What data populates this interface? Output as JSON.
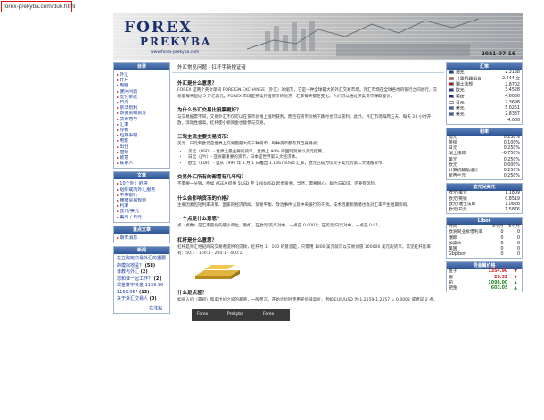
{
  "browser": {
    "url": "forex-prekyba.com/duk.html"
  },
  "banner": {
    "logo_top": "FOREX",
    "logo_bottom": "PREKYBA",
    "site_url": "www.forex-prekyba.com",
    "date": "2021-07-16"
  },
  "left": {
    "nav_title": "目录",
    "nav_items": [
      "外汇",
      "开户",
      "电脑",
      "使问问题",
      "支付条款",
      "日元",
      "依法划利",
      "该要贸细撰写",
      "货币符号",
      "汇率",
      "导致",
      "短期事物",
      "电影",
      "出仕",
      "描绘",
      "致意",
      "联系人"
    ],
    "nav2_title": "文章",
    "nav2_items": [
      "10个外汇陷阱",
      "组织或内外汇服务",
      "中央银行",
      "横彼贸易规则",
      "利率",
      "欧元/美元",
      "美元 / 日元"
    ],
    "nav3_title": "重点文章",
    "nav3_items": [
      "期市消息"
    ],
    "news_title": "新闻",
    "news": [
      {
        "text": "在立陶宛交易外汇的重要的模拟地是？",
        "count": "(58)"
      },
      {
        "text": "谁教与外汇",
        "count": "(2)"
      },
      {
        "text": "您和谁一起工作？",
        "count": "(2)"
      },
      {
        "text": "现金数字黄金 1159.95 1160.95?",
        "count": "(13)"
      },
      {
        "text": "关于外汇交易人",
        "count": "(0)"
      }
    ],
    "more": "在这些..."
  },
  "main": {
    "title": "外汇常见问题 - 扛杆手新搜证者",
    "h1": "外汇是什么意思？",
    "p1": "FOREX 是两个英文单词 FOREIGN EXCHANGE（外汇）的缩写，它是一种全球最大的外汇交易市场。外汇市场在全球各地的银行之间进行，交易量每天超过 5 万亿美元。FOREX 市场是买卖外国货币的地方，汇率每天都在变化，人们可以通过买卖货币赚取差价。",
    "h2": "为什么外汇交易比股票更好？",
    "p2": "与交易股票不同，交易外汇不仅可以在货币价格上涨时获利，而且在货币价格下跌时也可以获利。此外，外汇市场每周五天、每天 24 小时开放，流动性极高，杠杆使小额资金也能参与交易。",
    "h3": "三驾主流主要交易货币：",
    "p3": "美元、日元和欧元是世界上交易量最大的三种货币，每种货币都有其自身特点：",
    "list": [
      "美元（USD）- 世界上最主要的货币，世界上 90% 的国际贸易以美元结算。",
      "日元（JPY）- 亚洲最重要的货币，日本是世界第三大经济体。",
      "欧元（EUR）- 自从 1999 年 1 月 1 日推出 1.16675USD 汇率，欧元已成为仅次于美元的第二大储备货币。"
    ],
    "h4": "交易外汇所有的都需有几年吗？",
    "p4": "不需要一分钱，例如 AGEA 提供 5USD 至 1000USD 起步资金，当然，需要耐心、毅力与知识，还要有风险。",
    "h5": "什么会影响货币的价格？",
    "p5": "主要因素包括利率决策、国家的经济新闻、贸易平衡、政治事件以及中央银行的干预。技术因素和情绪也会对汇率产生短期影响。",
    "h6": "一个点是什么意思？",
    "p6": "点（点数）是汇率变化的最小单位。例如，在欧元/美元对中，一点是 0.0001；在美元/日元对中，一点是 0.01。",
    "h7": "杠杆是什么意思？",
    "p7": "杠杆是外汇经纪商向交易者提供的贷款，杠杆为 1：100 的意思是，只需用 1000 美元就可以交易价值 100000 美元的货币。常见杠杆比率有：50:1 · 100:1 · 200:1 · 400:1。",
    "h8": "什么是点差？",
    "p8": "如买入价（最初）和卖出价之间的差值，一般而言，开始计价时使用买价减卖价，例如 EUR/USD 为 1.2559-1.2557 = 0.0002 或者说 2 点。",
    "tv_labels": [
      "Forex",
      "Prekyba",
      "Forex"
    ]
  },
  "right": {
    "rates_title": "汇率",
    "rates": [
      {
        "name": "澳元",
        "value": "2.3138",
        "flag": "#1a3c9c"
      },
      {
        "name": "计量机器组合",
        "value": "2.444 立",
        "flag": "#ff3030"
      },
      {
        "name": "瑞士法郎",
        "value": "2.8702",
        "flag": "#d01010"
      },
      {
        "name": "欧元",
        "value": "3.4528",
        "flag": "#1a3c9c"
      },
      {
        "name": "英镑",
        "value": "4.6080",
        "flag": "#1a2c7c"
      },
      {
        "name": "日元",
        "value": "2.3698",
        "flag": "#ffffff"
      },
      {
        "name": "美元",
        "value": "5.0251",
        "flag": "#3060b0"
      },
      {
        "name": "美元",
        "value": "2.8387",
        "flag": "#3060b0"
      }
    ],
    "rates_note": "4.008",
    "interest_title": "利率",
    "interest": [
      {
        "name": "澳元",
        "value": "0.250%"
      },
      {
        "name": "英镑",
        "value": "0.100%"
      },
      {
        "name": "日元",
        "value": "0.250%"
      },
      {
        "name": "瑞士法郎",
        "value": "-0.750%"
      },
      {
        "name": "美元",
        "value": "0.250%"
      },
      {
        "name": "欧元",
        "value": "0.000%"
      },
      {
        "name": "计算机辅助设计",
        "value": "0.250%"
      },
      {
        "name": "新西兰元",
        "value": "0.250%"
      }
    ],
    "cross_title": "欧元兑美元",
    "cross": [
      {
        "name": "欧元/美元",
        "value": "1.1809"
      },
      {
        "name": "欧元/英镑",
        "value": "0.8519"
      },
      {
        "name": "欧元/瑞士法郎",
        "value": "1.0828"
      },
      {
        "name": "欧元/日元",
        "value": "1.5876"
      }
    ],
    "libor_title": "Libor",
    "libor_head": [
      "时间",
      "3个月",
      "6个月"
    ],
    "libor": [
      {
        "name": "欧洲同业拆借利率",
        "v1": "0",
        "v2": "0"
      },
      {
        "name": "瑞郎",
        "v1": "0",
        "v2": "0"
      },
      {
        "name": "加拿大",
        "v1": "0",
        "v2": "0"
      },
      {
        "name": "美国",
        "v1": "0",
        "v2": "0"
      },
      {
        "name": "Gbpibor",
        "v1": "0",
        "v2": "0"
      }
    ],
    "metals_title": "贵金属价格",
    "metals": [
      {
        "name": "金子",
        "value": "1354.90",
        "dir": "down"
      },
      {
        "name": "银",
        "value": "20.32",
        "dir": "down"
      },
      {
        "name": "铂",
        "value": "1098.00",
        "dir": "up"
      },
      {
        "name": "钯金",
        "value": "603.05",
        "dir": "up"
      }
    ]
  }
}
